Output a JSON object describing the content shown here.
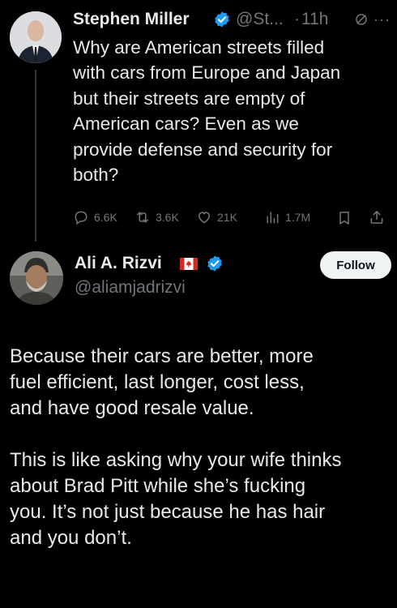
{
  "tweet1": {
    "name": "Stephen Miller",
    "handle": "@St...",
    "dot": "·",
    "time": "11h",
    "body": "Why are American streets filled\nwith cars from Europe and Japan\nbut their streets are empty of\nAmerican cars? Even as we\nprovide defense and security for\nboth?",
    "actions": {
      "replies": "6.6K",
      "reposts": "3.6K",
      "likes": "21K",
      "views": "1.7M"
    }
  },
  "tweet2": {
    "name": "Ali A. Rizvi",
    "flag": "canada-flag",
    "handle": "@aliamjadrizvi",
    "follow_label": "Follow",
    "body": "Because their cars are better, more\nfuel efficient, last longer, cost less,\nand have good resale value.\n\nThis is like asking why your wife thinks\nabout Brad Pitt while she’s fucking\nyou. It’s not just because he has hair\nand you don’t."
  },
  "colors": {
    "background": "#000000",
    "text": "#e7e9ea",
    "muted": "#71767b",
    "verified": "#1d9bf0",
    "follow_bg": "#eff3f4"
  }
}
